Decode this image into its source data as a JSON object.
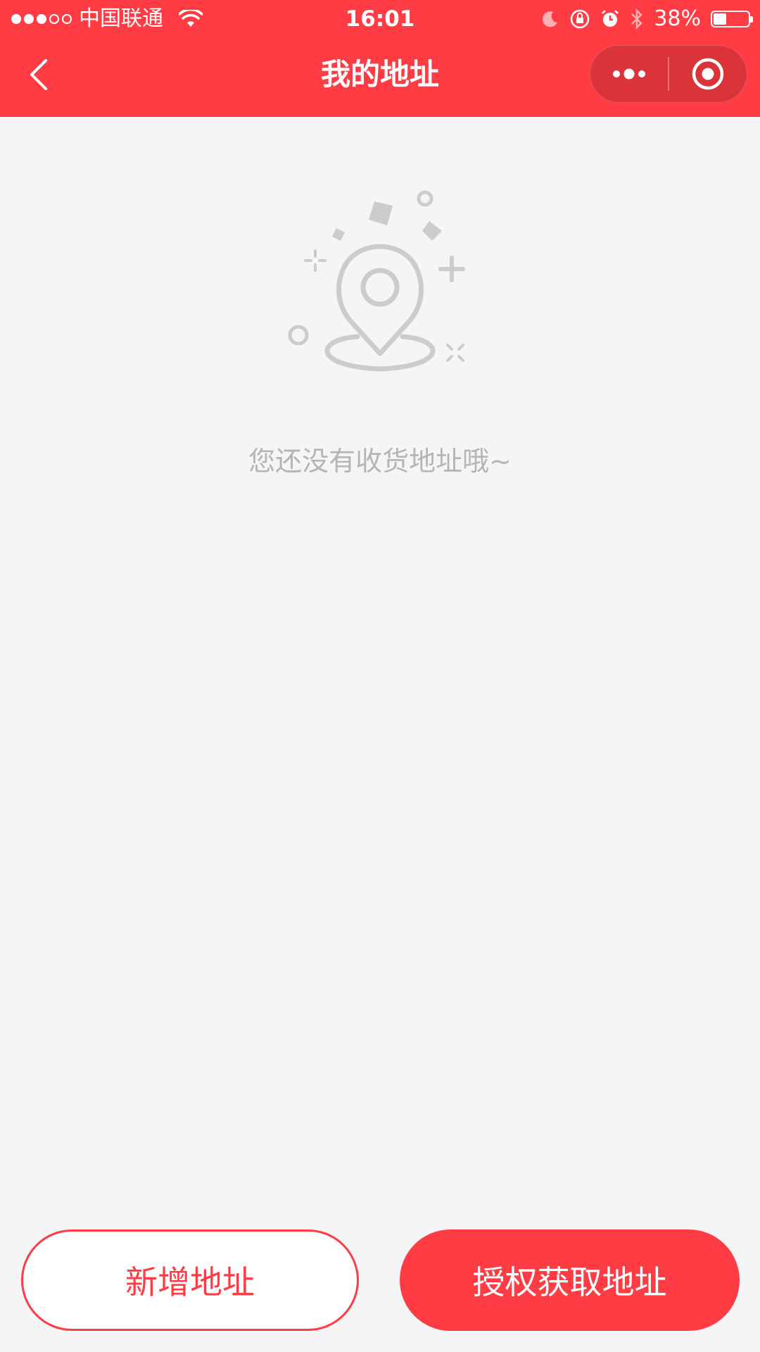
{
  "status_bar": {
    "carrier": "中国联通",
    "time": "16:01",
    "battery_percent": "38%",
    "battery_level": 0.38
  },
  "nav": {
    "title": "我的地址",
    "back_icon": "chevron-left-icon",
    "more_icon": "more-dots-icon",
    "close_icon": "target-circle-icon"
  },
  "empty_state": {
    "icon": "location-pin-icon",
    "message": "您还没有收货地址哦~"
  },
  "actions": {
    "add_label": "新增地址",
    "authorize_label": "授权获取地址"
  },
  "colors": {
    "brand": "#ff3c44",
    "background": "#f5f5f5",
    "muted_text": "#b5b5b5",
    "illustration": "#cccccc"
  }
}
